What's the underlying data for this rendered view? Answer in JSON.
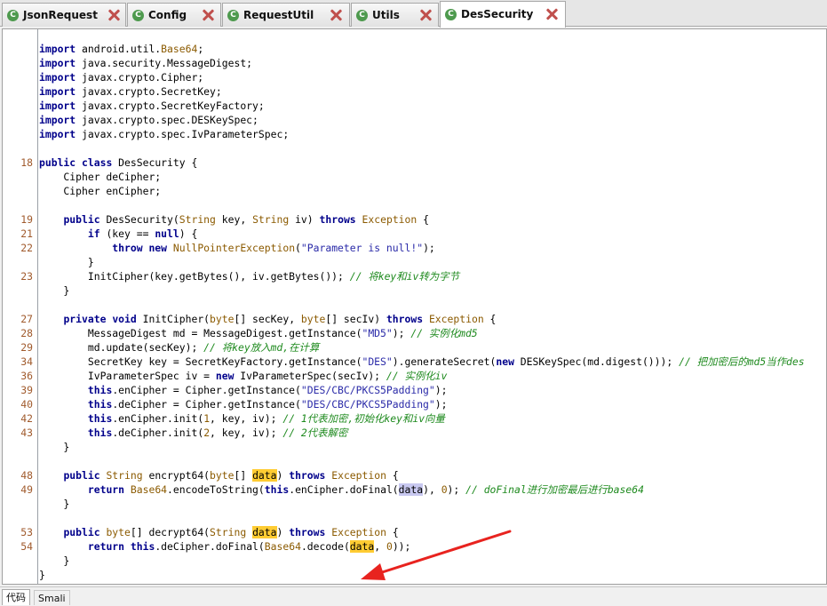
{
  "tabs": [
    {
      "label": "JsonRequest",
      "active": false
    },
    {
      "label": "Config",
      "active": false
    },
    {
      "label": "RequestUtil",
      "active": false
    },
    {
      "label": "Utils",
      "active": false
    },
    {
      "label": "DesSecurity",
      "active": true
    }
  ],
  "tab_icon_letter": "C",
  "editor": {
    "lines": [
      {
        "ln": "",
        "code": "import android.util.Base64;"
      },
      {
        "ln": "",
        "code": "import java.security.MessageDigest;"
      },
      {
        "ln": "",
        "code": "import javax.crypto.Cipher;"
      },
      {
        "ln": "",
        "code": "import javax.crypto.SecretKey;"
      },
      {
        "ln": "",
        "code": "import javax.crypto.SecretKeyFactory;"
      },
      {
        "ln": "",
        "code": "import javax.crypto.spec.DESKeySpec;"
      },
      {
        "ln": "",
        "code": "import javax.crypto.spec.IvParameterSpec;"
      },
      {
        "ln": "",
        "code": ""
      },
      {
        "ln": "18",
        "code": "public class DesSecurity {"
      },
      {
        "ln": "",
        "code": "    Cipher deCipher;"
      },
      {
        "ln": "",
        "code": "    Cipher enCipher;"
      },
      {
        "ln": "",
        "code": ""
      },
      {
        "ln": "19",
        "code": "    public DesSecurity(String key, String iv) throws Exception {"
      },
      {
        "ln": "21",
        "code": "        if (key == null) {"
      },
      {
        "ln": "22",
        "code": "            throw new NullPointerException(\"Parameter is null!\");"
      },
      {
        "ln": "",
        "code": "        }"
      },
      {
        "ln": "23",
        "code": "        InitCipher(key.getBytes(), iv.getBytes()); // 将key和iv转为字节"
      },
      {
        "ln": "",
        "code": "    }"
      },
      {
        "ln": "",
        "code": ""
      },
      {
        "ln": "27",
        "code": "    private void InitCipher(byte[] secKey, byte[] secIv) throws Exception {"
      },
      {
        "ln": "28",
        "code": "        MessageDigest md = MessageDigest.getInstance(\"MD5\"); // 实例化md5"
      },
      {
        "ln": "29",
        "code": "        md.update(secKey); // 将key放入md,在计算"
      },
      {
        "ln": "34",
        "code": "        SecretKey key = SecretKeyFactory.getInstance(\"DES\").generateSecret(new DESKeySpec(md.digest())); // 把加密后的md5当作des"
      },
      {
        "ln": "36",
        "code": "        IvParameterSpec iv = new IvParameterSpec(secIv); // 实例化iv"
      },
      {
        "ln": "39",
        "code": "        this.enCipher = Cipher.getInstance(\"DES/CBC/PKCS5Padding\");"
      },
      {
        "ln": "40",
        "code": "        this.deCipher = Cipher.getInstance(\"DES/CBC/PKCS5Padding\");"
      },
      {
        "ln": "42",
        "code": "        this.enCipher.init(1, key, iv); // 1代表加密,初始化key和iv向量"
      },
      {
        "ln": "43",
        "code": "        this.deCipher.init(2, key, iv); // 2代表解密"
      },
      {
        "ln": "",
        "code": "    }"
      },
      {
        "ln": "",
        "code": ""
      },
      {
        "ln": "48",
        "code": "    public String encrypt64(byte[] data) throws Exception {"
      },
      {
        "ln": "49",
        "code": "        return Base64.encodeToString(this.enCipher.doFinal(data), 0); // doFinal进行加密最后进行base64"
      },
      {
        "ln": "",
        "code": "    }"
      },
      {
        "ln": "",
        "code": ""
      },
      {
        "ln": "53",
        "code": "    public byte[] decrypt64(String data) throws Exception {"
      },
      {
        "ln": "54",
        "code": "        return this.deCipher.doFinal(Base64.decode(data, 0));"
      },
      {
        "ln": "",
        "code": "    }"
      },
      {
        "ln": "",
        "code": "}"
      }
    ]
  },
  "bottom_tabs": [
    {
      "label": "代码",
      "active": true
    },
    {
      "label": "Smali",
      "active": false
    }
  ],
  "colors": {
    "keyword": "#00008b",
    "type": "#8b5a00",
    "string": "#2a2aa8",
    "comment": "#1e8a1e",
    "line_number": "#a05a2c",
    "highlight": "#ffcc33",
    "arrow": "#e8231f",
    "close_icon": "#c0504d",
    "class_icon": "#4e9a4e"
  },
  "icons": {
    "tab_class": "class-c-icon",
    "tab_close": "close-icon",
    "annotation": "red-arrow-icon"
  }
}
